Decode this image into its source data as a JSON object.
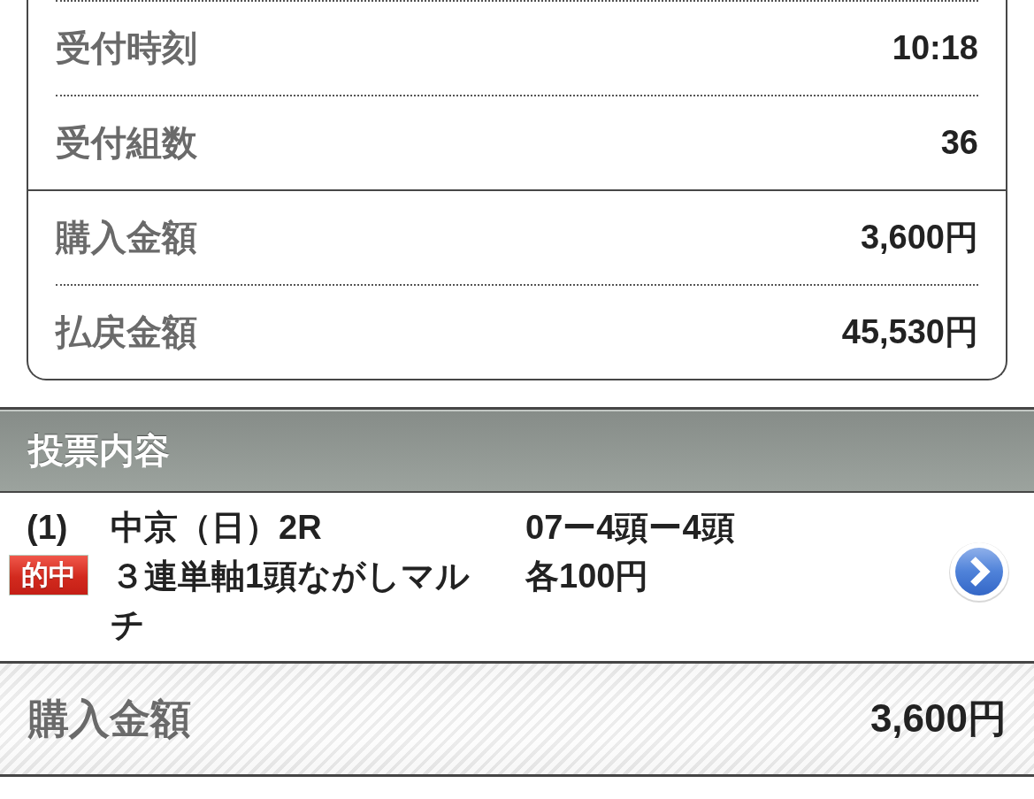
{
  "summary": {
    "groups": [
      {
        "rows": [
          {
            "label": "受付時刻",
            "value": "10:18"
          },
          {
            "label": "受付組数",
            "value": "36"
          }
        ]
      },
      {
        "rows": [
          {
            "label": "購入金額",
            "value": "3,600円"
          },
          {
            "label": "払戻金額",
            "value": "45,530円"
          }
        ]
      }
    ]
  },
  "bet_section": {
    "title": "投票内容",
    "bets": [
      {
        "number": "(1)",
        "badge": "的中",
        "race": "中京（日）2R",
        "bet_type": "３連単軸1頭ながしマルチ",
        "selection": "07ー4頭ー4頭",
        "amount": "各100円"
      }
    ]
  },
  "total": {
    "label": "購入金額",
    "value": "3,600円"
  }
}
